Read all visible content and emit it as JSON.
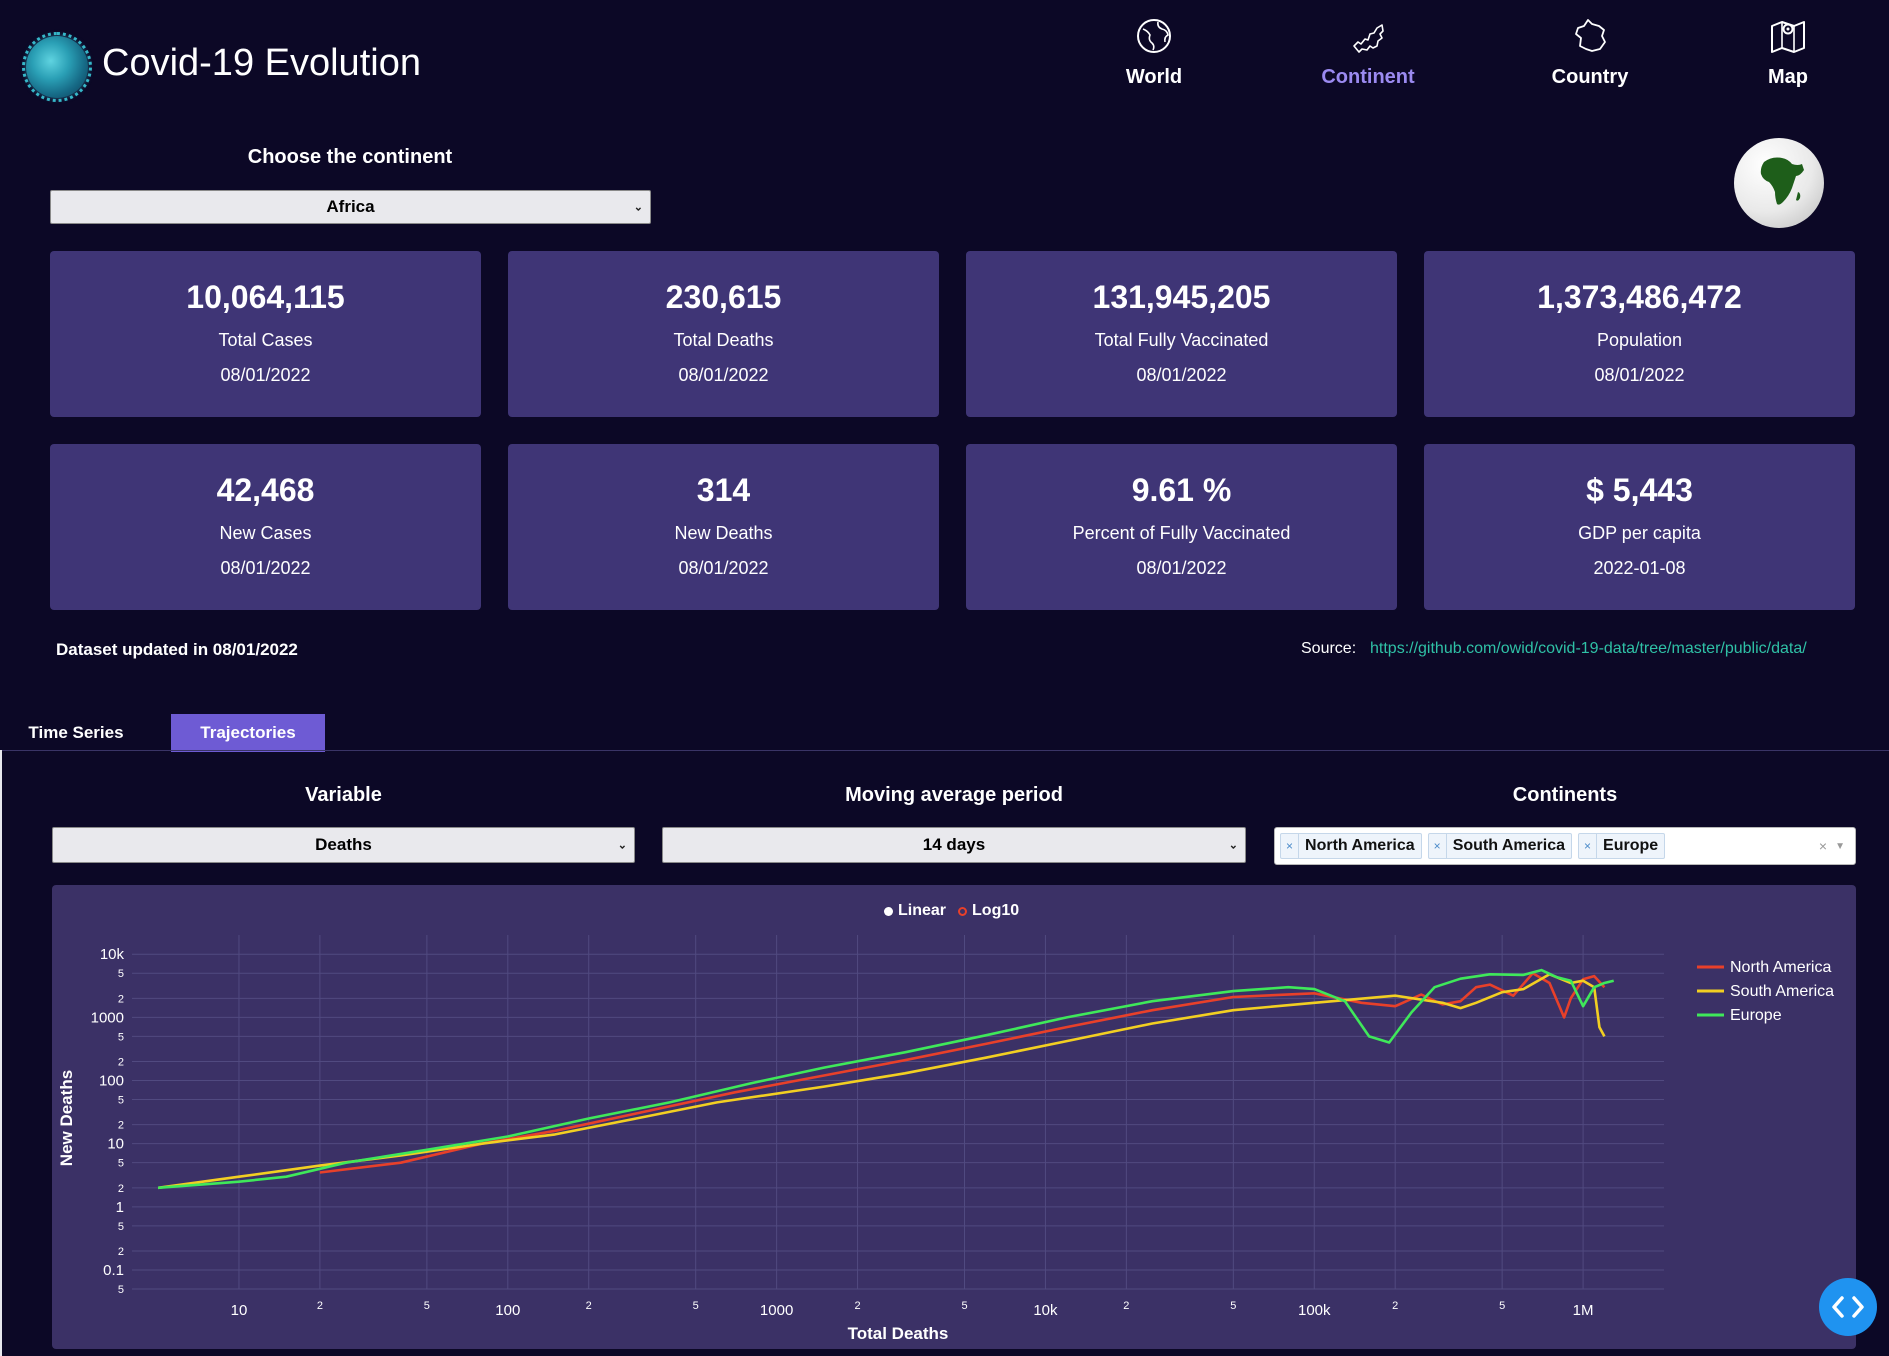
{
  "header": {
    "title": "Covid-19 Evolution",
    "nav": [
      {
        "label": "World",
        "icon": "globe-icon"
      },
      {
        "label": "Continent",
        "icon": "continent-map-icon",
        "active": true
      },
      {
        "label": "Country",
        "icon": "country-map-icon"
      },
      {
        "label": "Map",
        "icon": "map-icon"
      }
    ]
  },
  "continent_select": {
    "label": "Choose the continent",
    "value": "Africa"
  },
  "cards": [
    {
      "value": "10,064,115",
      "caption": "Total Cases",
      "date": "08/01/2022"
    },
    {
      "value": "230,615",
      "caption": "Total Deaths",
      "date": "08/01/2022"
    },
    {
      "value": "131,945,205",
      "caption": "Total Fully Vaccinated",
      "date": "08/01/2022"
    },
    {
      "value": "1,373,486,472",
      "caption": "Population",
      "date": "08/01/2022"
    },
    {
      "value": "42,468",
      "caption": "New Cases",
      "date": "08/01/2022"
    },
    {
      "value": "314",
      "caption": "New Deaths",
      "date": "08/01/2022"
    },
    {
      "value": "9.61 %",
      "caption": "Percent of Fully Vaccinated",
      "date": "08/01/2022"
    },
    {
      "value": "$ 5,443",
      "caption": "GDP per capita",
      "date": "2022-01-08"
    }
  ],
  "footer": {
    "updated": "Dataset updated in 08/01/2022",
    "source_label": "Source:",
    "source_url": "https://github.com/owid/covid-19-data/tree/master/public/data/"
  },
  "tabs": [
    {
      "label": "Time Series",
      "active": false
    },
    {
      "label": "Trajectories",
      "active": true
    }
  ],
  "controls": {
    "variable": {
      "label": "Variable",
      "value": "Deaths"
    },
    "moving_average": {
      "label": "Moving average period",
      "value": "14 days"
    },
    "continents": {
      "label": "Continents",
      "selected": [
        "North America",
        "South America",
        "Europe"
      ]
    }
  },
  "scale_toggle": {
    "options": [
      {
        "label": "Linear",
        "selected": true
      },
      {
        "label": "Log10",
        "selected": false
      }
    ]
  },
  "colors": {
    "background": "#0c0826",
    "card": "#3f3576",
    "active_nav": "#9b8af0",
    "active_tab": "#6e5bd4",
    "link": "#2fc1a6"
  },
  "chart_data": {
    "type": "line",
    "xlabel": "Total Deaths",
    "ylabel": "New Deaths",
    "xscale": "log",
    "yscale": "log",
    "xlim": [
      4,
      2000000
    ],
    "ylim": [
      0.05,
      13000
    ],
    "x_ticks": [
      {
        "v": 10,
        "label": "10"
      },
      {
        "v": 20,
        "label": "2"
      },
      {
        "v": 50,
        "label": "5"
      },
      {
        "v": 100,
        "label": "100"
      },
      {
        "v": 200,
        "label": "2"
      },
      {
        "v": 500,
        "label": "5"
      },
      {
        "v": 1000,
        "label": "1000"
      },
      {
        "v": 2000,
        "label": "2"
      },
      {
        "v": 5000,
        "label": "5"
      },
      {
        "v": 10000,
        "label": "10k"
      },
      {
        "v": 20000,
        "label": "2"
      },
      {
        "v": 50000,
        "label": "5"
      },
      {
        "v": 100000,
        "label": "100k"
      },
      {
        "v": 200000,
        "label": "2"
      },
      {
        "v": 500000,
        "label": "5"
      },
      {
        "v": 1000000,
        "label": "1M"
      }
    ],
    "y_ticks": [
      {
        "v": 10000,
        "label": "10k"
      },
      {
        "v": 5000,
        "label": "5"
      },
      {
        "v": 2000,
        "label": "2"
      },
      {
        "v": 1000,
        "label": "1000"
      },
      {
        "v": 500,
        "label": "5"
      },
      {
        "v": 200,
        "label": "2"
      },
      {
        "v": 100,
        "label": "100"
      },
      {
        "v": 50,
        "label": "5"
      },
      {
        "v": 20,
        "label": "2"
      },
      {
        "v": 10,
        "label": "10"
      },
      {
        "v": 5,
        "label": "5"
      },
      {
        "v": 2,
        "label": "2"
      },
      {
        "v": 1,
        "label": "1"
      },
      {
        "v": 0.5,
        "label": "5"
      },
      {
        "v": 0.2,
        "label": "2"
      },
      {
        "v": 0.1,
        "label": "0.1"
      },
      {
        "v": 0.05,
        "label": "5"
      }
    ],
    "legend_position": "right",
    "series": [
      {
        "name": "North America",
        "color": "#e8402a",
        "points": [
          [
            20,
            3.5
          ],
          [
            40,
            5
          ],
          [
            80,
            10
          ],
          [
            150,
            16
          ],
          [
            300,
            30
          ],
          [
            700,
            65
          ],
          [
            1500,
            120
          ],
          [
            3000,
            210
          ],
          [
            6000,
            380
          ],
          [
            12000,
            700
          ],
          [
            25000,
            1300
          ],
          [
            50000,
            2100
          ],
          [
            100000,
            2400
          ],
          [
            150000,
            1700
          ],
          [
            200000,
            1500
          ],
          [
            250000,
            2300
          ],
          [
            300000,
            1600
          ],
          [
            350000,
            1800
          ],
          [
            400000,
            3000
          ],
          [
            450000,
            3300
          ],
          [
            550000,
            2200
          ],
          [
            650000,
            5000
          ],
          [
            750000,
            3500
          ],
          [
            850000,
            1000
          ],
          [
            900000,
            2000
          ],
          [
            1000000,
            4000
          ],
          [
            1100000,
            4500
          ],
          [
            1200000,
            3000
          ]
        ]
      },
      {
        "name": "South America",
        "color": "#f2cf22",
        "points": [
          [
            5,
            2
          ],
          [
            10,
            3
          ],
          [
            20,
            4.5
          ],
          [
            40,
            6.5
          ],
          [
            80,
            10
          ],
          [
            150,
            14
          ],
          [
            300,
            25
          ],
          [
            600,
            45
          ],
          [
            1500,
            80
          ],
          [
            3000,
            130
          ],
          [
            6000,
            230
          ],
          [
            12000,
            420
          ],
          [
            25000,
            800
          ],
          [
            50000,
            1300
          ],
          [
            100000,
            1700
          ],
          [
            200000,
            2200
          ],
          [
            300000,
            1700
          ],
          [
            350000,
            1400
          ],
          [
            400000,
            1700
          ],
          [
            500000,
            2500
          ],
          [
            600000,
            2800
          ],
          [
            750000,
            4800
          ],
          [
            900000,
            3500
          ],
          [
            1000000,
            3800
          ],
          [
            1100000,
            3000
          ],
          [
            1150000,
            700
          ],
          [
            1200000,
            500
          ]
        ]
      },
      {
        "name": "Europe",
        "color": "#3fe85a",
        "points": [
          [
            5,
            2
          ],
          [
            10,
            2.5
          ],
          [
            15,
            3
          ],
          [
            25,
            5
          ],
          [
            50,
            8
          ],
          [
            100,
            13
          ],
          [
            200,
            25
          ],
          [
            400,
            45
          ],
          [
            800,
            90
          ],
          [
            1500,
            160
          ],
          [
            3000,
            280
          ],
          [
            6000,
            520
          ],
          [
            12000,
            1000
          ],
          [
            25000,
            1800
          ],
          [
            50000,
            2600
          ],
          [
            80000,
            3000
          ],
          [
            100000,
            2800
          ],
          [
            130000,
            1800
          ],
          [
            160000,
            500
          ],
          [
            190000,
            400
          ],
          [
            230000,
            1200
          ],
          [
            280000,
            3000
          ],
          [
            350000,
            4100
          ],
          [
            450000,
            4800
          ],
          [
            600000,
            4700
          ],
          [
            700000,
            5600
          ],
          [
            800000,
            4300
          ],
          [
            900000,
            3800
          ],
          [
            1000000,
            1500
          ],
          [
            1100000,
            3000
          ],
          [
            1200000,
            3500
          ],
          [
            1300000,
            3800
          ]
        ]
      }
    ]
  }
}
